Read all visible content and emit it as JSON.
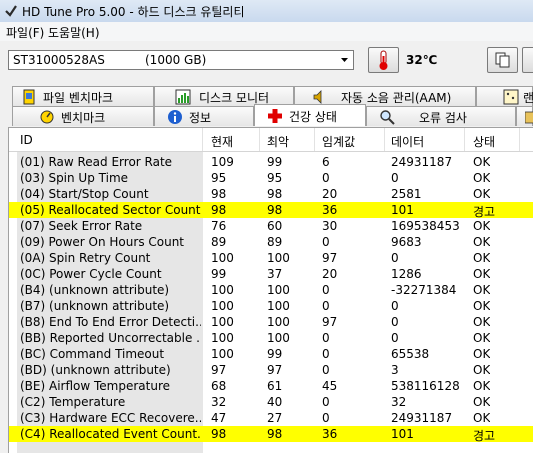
{
  "window": {
    "title": "HD Tune Pro 5.00 - 하드 디스크 유틸리티"
  },
  "menu": {
    "file": "파일(F)",
    "help": "도움말(H)"
  },
  "toolbar": {
    "drive_model": "ST31000528AS",
    "drive_capacity": "(1000 GB)",
    "temperature": "32℃"
  },
  "tabs_top": [
    {
      "label": "파일 벤치마크",
      "icon": "file-benchmark-icon"
    },
    {
      "label": "디스크 모니터",
      "icon": "disk-monitor-icon"
    },
    {
      "label": "자동 소음 관리(AAM)",
      "icon": "speaker-icon"
    },
    {
      "label": "랜",
      "icon": "random-access-icon"
    }
  ],
  "tabs_bottom": [
    {
      "label": "벤치마크",
      "icon": "benchmark-icon"
    },
    {
      "label": "정보",
      "icon": "info-icon"
    },
    {
      "label": "건강 상태",
      "icon": "health-cross-icon",
      "active": true
    },
    {
      "label": "오류 검사",
      "icon": "magnifier-icon"
    }
  ],
  "table": {
    "headers": [
      "ID",
      "현재",
      "최악",
      "임계값",
      "데이터",
      "상태"
    ],
    "rows": [
      {
        "id": "(01) Raw Read Error Rate",
        "cur": "109",
        "worst": "99",
        "thr": "6",
        "data": "24931187",
        "status": "OK",
        "warn": false
      },
      {
        "id": "(03) Spin Up Time",
        "cur": "95",
        "worst": "95",
        "thr": "0",
        "data": "0",
        "status": "OK",
        "warn": false
      },
      {
        "id": "(04) Start/Stop Count",
        "cur": "98",
        "worst": "98",
        "thr": "20",
        "data": "2581",
        "status": "OK",
        "warn": false
      },
      {
        "id": "(05) Reallocated Sector Count...",
        "cur": "98",
        "worst": "98",
        "thr": "36",
        "data": "101",
        "status": "경고",
        "warn": true
      },
      {
        "id": "(07) Seek Error Rate",
        "cur": "76",
        "worst": "60",
        "thr": "30",
        "data": "169538453",
        "status": "OK",
        "warn": false
      },
      {
        "id": "(09) Power On Hours Count",
        "cur": "89",
        "worst": "89",
        "thr": "0",
        "data": "9683",
        "status": "OK",
        "warn": false
      },
      {
        "id": "(0A) Spin Retry Count",
        "cur": "100",
        "worst": "100",
        "thr": "97",
        "data": "0",
        "status": "OK",
        "warn": false
      },
      {
        "id": "(0C) Power Cycle Count",
        "cur": "99",
        "worst": "37",
        "thr": "20",
        "data": "1286",
        "status": "OK",
        "warn": false
      },
      {
        "id": "(B4) (unknown attribute)",
        "cur": "100",
        "worst": "100",
        "thr": "0",
        "data": "-32271384",
        "status": "OK",
        "warn": false
      },
      {
        "id": "(B7) (unknown attribute)",
        "cur": "100",
        "worst": "100",
        "thr": "0",
        "data": "0",
        "status": "OK",
        "warn": false
      },
      {
        "id": "(B8) End To End Error Detecti...",
        "cur": "100",
        "worst": "100",
        "thr": "97",
        "data": "0",
        "status": "OK",
        "warn": false
      },
      {
        "id": "(BB) Reported Uncorrectable ...",
        "cur": "100",
        "worst": "100",
        "thr": "0",
        "data": "0",
        "status": "OK",
        "warn": false
      },
      {
        "id": "(BC) Command Timeout",
        "cur": "100",
        "worst": "99",
        "thr": "0",
        "data": "65538",
        "status": "OK",
        "warn": false
      },
      {
        "id": "(BD) (unknown attribute)",
        "cur": "97",
        "worst": "97",
        "thr": "0",
        "data": "3",
        "status": "OK",
        "warn": false
      },
      {
        "id": "(BE) Airflow Temperature",
        "cur": "68",
        "worst": "61",
        "thr": "45",
        "data": "538116128",
        "status": "OK",
        "warn": false
      },
      {
        "id": "(C2) Temperature",
        "cur": "32",
        "worst": "40",
        "thr": "0",
        "data": "32",
        "status": "OK",
        "warn": false
      },
      {
        "id": "(C3) Hardware ECC Recovere...",
        "cur": "47",
        "worst": "27",
        "thr": "0",
        "data": "24931187",
        "status": "OK",
        "warn": false
      },
      {
        "id": "(C4) Reallocated Event Count...",
        "cur": "98",
        "worst": "98",
        "thr": "36",
        "data": "101",
        "status": "경고",
        "warn": true
      }
    ]
  },
  "colors": {
    "warn_highlight": "#ffff00",
    "id_column_bg": "#e6e6e6",
    "selected_tab": "#ffffff"
  }
}
